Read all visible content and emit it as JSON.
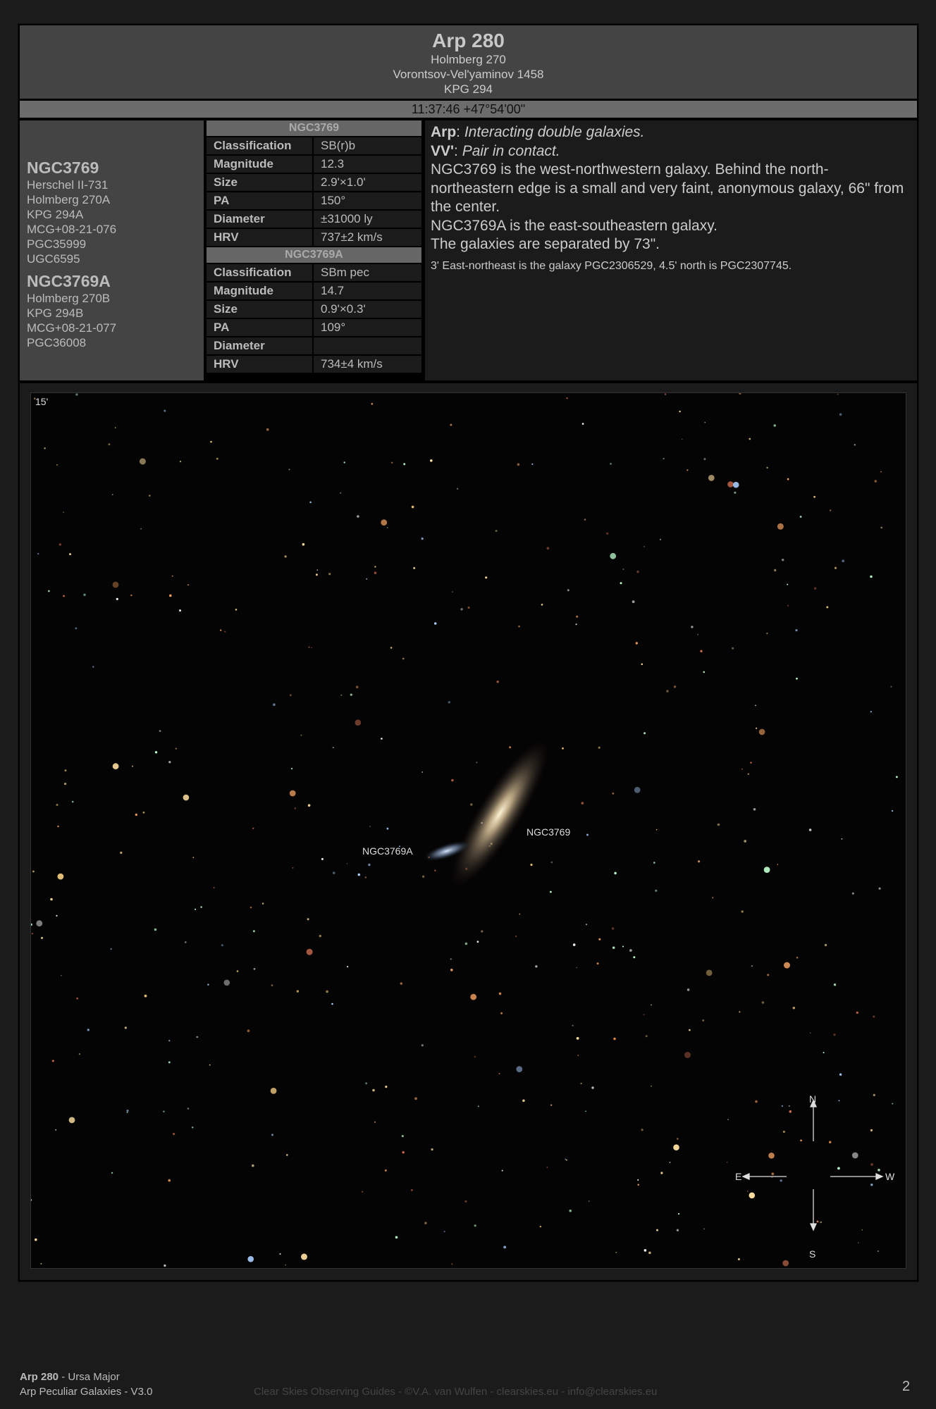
{
  "header": {
    "title": "Arp 280",
    "aliases": [
      "Holmberg 270",
      "Vorontsov-Vel'yaminov 1458",
      "KPG 294"
    ],
    "coordinates": "11:37:46 +47°54'00\""
  },
  "objects": [
    {
      "name": "NGC3769",
      "aliases": [
        "Herschel II-731",
        "Holmberg 270A",
        "KPG 294A",
        "MCG+08-21-076",
        "PGC35999",
        "UGC6595"
      ],
      "rows": [
        [
          "Classification",
          "SB(r)b"
        ],
        [
          "Magnitude",
          "12.3"
        ],
        [
          "Size",
          "2.9'×1.0'"
        ],
        [
          "PA",
          "150°"
        ],
        [
          "Diameter",
          "±31000 ly"
        ],
        [
          "HRV",
          "737±2 km/s"
        ]
      ]
    },
    {
      "name": "NGC3769A",
      "aliases": [
        "Holmberg 270B",
        "KPG 294B",
        "MCG+08-21-077",
        "PGC36008"
      ],
      "rows": [
        [
          "Classification",
          "SBm pec"
        ],
        [
          "Magnitude",
          "14.7"
        ],
        [
          "Size",
          "0.9'×0.3'"
        ],
        [
          "PA",
          "109°"
        ],
        [
          "Diameter",
          ""
        ],
        [
          "HRV",
          "734±4 km/s"
        ]
      ]
    }
  ],
  "description": {
    "arp_label": "Arp",
    "arp_text": "Interacting double galaxies.",
    "vv_label": "VV'",
    "vv_text": "Pair in contact.",
    "lines": [
      "NGC3769 is the west-northwestern galaxy. Behind the north-northeastern edge is a small and very faint, anonymous galaxy, 66\" from the center.",
      "NGC3769A is the east-southeastern galaxy.",
      "The galaxies are separated by 73\"."
    ],
    "note": "3' East-northeast is the galaxy PGC2306529, 4.5' north is PGC2307745."
  },
  "image": {
    "scale_label": "15'",
    "labels": {
      "ngc3769": "NGC3769",
      "ngc3769a": "NGC3769A"
    },
    "compass": {
      "n": "N",
      "s": "S",
      "e": "E",
      "w": "W"
    }
  },
  "footer": {
    "object": "Arp 280",
    "constellation": " - Ursa Major",
    "series": "Arp Peculiar Galaxies - V3.0",
    "credits": "Clear Skies Observing Guides - ©V.A. van Wulfen - clearskies.eu - info@clearskies.eu",
    "page": "2"
  }
}
